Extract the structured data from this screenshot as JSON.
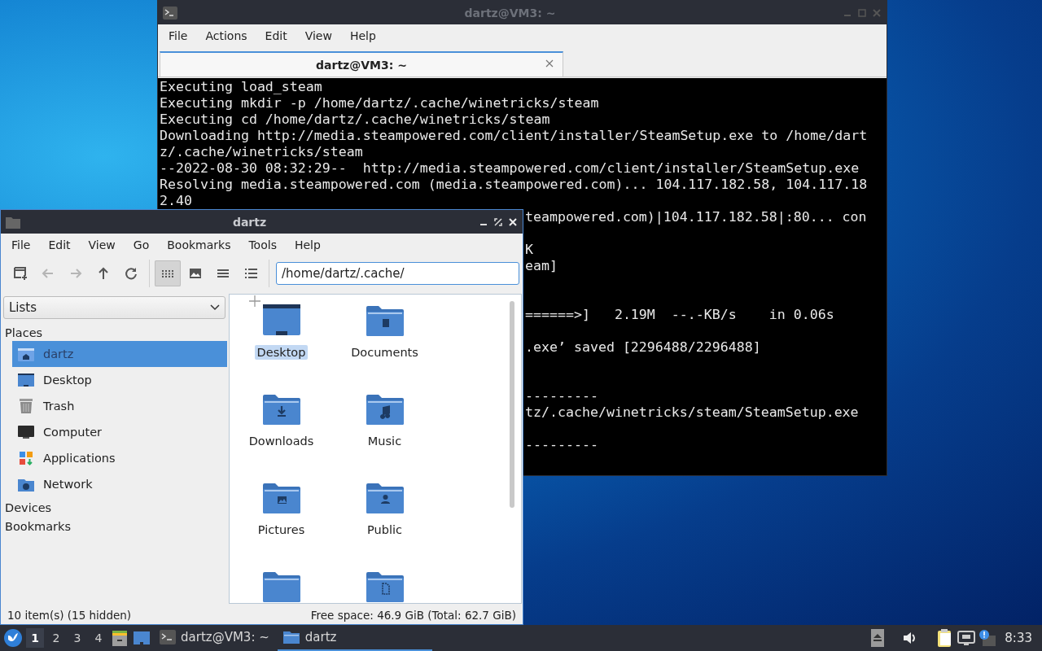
{
  "terminal_window": {
    "title": "dartz@VM3: ~",
    "menu": [
      "File",
      "Actions",
      "Edit",
      "View",
      "Help"
    ],
    "tabs": [
      {
        "label": "dartz@VM3: ~",
        "selected": true
      }
    ],
    "lines": [
      {
        "kind": "full",
        "text": "Executing load_steam"
      },
      {
        "kind": "full",
        "text": "Executing mkdir -p /home/dartz/.cache/winetricks/steam"
      },
      {
        "kind": "full",
        "text": "Executing cd /home/dartz/.cache/winetricks/steam"
      },
      {
        "kind": "full",
        "text": "Downloading http://media.steampowered.com/client/installer/SteamSetup.exe to /home/dart"
      },
      {
        "kind": "full",
        "text": "z/.cache/winetricks/steam"
      },
      {
        "kind": "full",
        "text": "--2022-08-30 08:32:29--  http://media.steampowered.com/client/installer/SteamSetup.exe"
      },
      {
        "kind": "full",
        "text": "Resolving media.steampowered.com (media.steampowered.com)... 104.117.182.58, 104.117.18"
      },
      {
        "kind": "full",
        "text": "2.40"
      },
      {
        "kind": "covered",
        "text": "teampowered.com)|104.117.182.58|:80... con"
      },
      {
        "kind": "blank"
      },
      {
        "kind": "covered",
        "text": "K"
      },
      {
        "kind": "covered",
        "text": "eam]"
      },
      {
        "kind": "blank"
      },
      {
        "kind": "blank"
      },
      {
        "kind": "covered",
        "text": "======>]   2.19M  --.-KB/s    in 0.06s"
      },
      {
        "kind": "blank"
      },
      {
        "kind": "covered",
        "text": ".exe’ saved [2296488/2296488]"
      },
      {
        "kind": "blank"
      },
      {
        "kind": "blank"
      },
      {
        "kind": "covered",
        "text": "---------"
      },
      {
        "kind": "covered",
        "text": "tz/.cache/winetricks/steam/SteamSetup.exe"
      },
      {
        "kind": "blank"
      },
      {
        "kind": "covered",
        "text": "---------"
      }
    ]
  },
  "file_manager": {
    "title": "dartz",
    "menu": [
      "File",
      "Edit",
      "View",
      "Go",
      "Bookmarks",
      "Tools",
      "Help"
    ],
    "nav_buttons": [
      {
        "kind": "new-tab",
        "disabled": false
      },
      {
        "kind": "back",
        "disabled": true
      },
      {
        "kind": "forward",
        "disabled": true
      },
      {
        "kind": "up",
        "disabled": false
      },
      {
        "kind": "reload",
        "disabled": false
      }
    ],
    "view_modes": [
      {
        "kind": "icons",
        "selected": true
      },
      {
        "kind": "thumbnails",
        "selected": false
      },
      {
        "kind": "compact",
        "selected": false
      },
      {
        "kind": "details",
        "selected": false
      }
    ],
    "location": "/home/dartz/.cache/",
    "side_pane_mode": "Lists",
    "places_header": "Places",
    "places": [
      {
        "label": "dartz",
        "kind": "home",
        "selected": true
      },
      {
        "label": "Desktop",
        "kind": "desktop",
        "selected": false
      },
      {
        "label": "Trash",
        "kind": "trash",
        "selected": false
      },
      {
        "label": "Computer",
        "kind": "computer",
        "selected": false
      },
      {
        "label": "Applications",
        "kind": "applications",
        "selected": false
      },
      {
        "label": "Network",
        "kind": "network",
        "selected": false
      }
    ],
    "sections": [
      "Devices",
      "Bookmarks"
    ],
    "files": [
      {
        "name": "Desktop",
        "kind": "desktop",
        "selected": true
      },
      {
        "name": "Documents",
        "kind": "documents",
        "selected": false
      },
      {
        "name": "Downloads",
        "kind": "downloads",
        "selected": false
      },
      {
        "name": "Music",
        "kind": "music",
        "selected": false
      },
      {
        "name": "Pictures",
        "kind": "pictures",
        "selected": false
      },
      {
        "name": "Public",
        "kind": "public",
        "selected": false
      },
      {
        "kind": "plain"
      },
      {
        "kind": "templates"
      }
    ],
    "status_left": "10 item(s) (15 hidden)",
    "status_right": "Free space: 46.9 GiB (Total: 62.7 GiB)"
  },
  "taskbar": {
    "workspaces": [
      {
        "label": "1",
        "selected": true
      },
      {
        "label": "2",
        "selected": false
      },
      {
        "label": "3",
        "selected": false
      },
      {
        "label": "4",
        "selected": false
      }
    ],
    "tasks": [
      {
        "label": "dartz@VM3: ~",
        "kind": "terminal",
        "selected": false
      },
      {
        "label": "dartz",
        "kind": "folder",
        "selected": true
      }
    ],
    "clock": "8:33"
  }
}
